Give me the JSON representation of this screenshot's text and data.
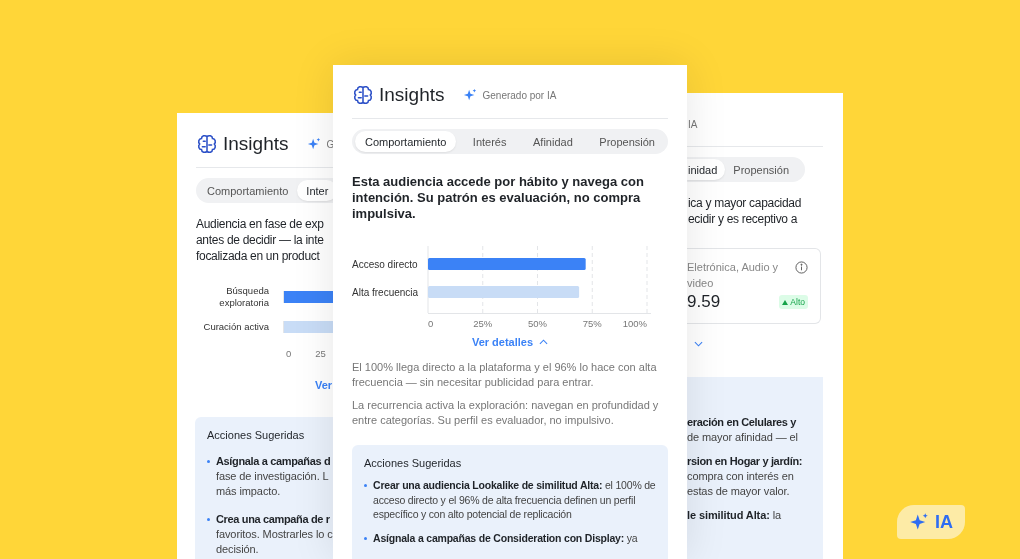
{
  "left_card": {
    "title": "Insights",
    "ai_label": "G",
    "tabs": [
      {
        "label": "Comportamiento",
        "selected": false
      },
      {
        "label": "Inter",
        "selected": true
      }
    ],
    "summary_lines": [
      "Audiencia en fase de exp",
      "antes de decidir — la inte",
      "focalizada en un product"
    ],
    "chart": {
      "categories": [
        "Búsqueda exploratoria",
        "Curación activa"
      ],
      "ticks": [
        "0",
        "25"
      ]
    },
    "link": "Ver",
    "actions": {
      "title": "Acciones Sugeridas",
      "items": [
        {
          "lines": [
            {
              "text": "Asígnala a campañas d",
              "bold": true
            },
            {
              "text": "fase de investigación. L",
              "bold": false
            },
            {
              "text": "más impacto.",
              "bold": false
            }
          ]
        },
        {
          "lines": [
            {
              "text": "Crea una campaña de r",
              "bold": true
            },
            {
              "text": "favoritos. Mostrarles lo c",
              "bold": false
            },
            {
              "text": "decisión.",
              "bold": false
            }
          ]
        }
      ]
    }
  },
  "center_card": {
    "title": "Insights",
    "ai_label": "Generado por IA",
    "tabs": [
      {
        "label": "Comportamiento",
        "selected": true
      },
      {
        "label": "Interés",
        "selected": false
      },
      {
        "label": "Afinidad",
        "selected": false
      },
      {
        "label": "Propensión",
        "selected": false
      }
    ],
    "summary": "Esta audiencia accede por hábito y navega con intención. Su patrón es evaluación, no compra impulsiva.",
    "chart_data": {
      "type": "bar",
      "orientation": "horizontal",
      "grid": true,
      "categories": [
        "Acceso directo",
        "Alta frecuencia"
      ],
      "series": [
        {
          "color": "#3b82f6",
          "values": [
            72,
            null
          ]
        },
        {
          "color": "#c8dcf6",
          "values": [
            null,
            69
          ]
        }
      ],
      "xlim": [
        0,
        100
      ],
      "xticks": [
        {
          "value": 0,
          "label": "0"
        },
        {
          "value": 25,
          "label": "25%"
        },
        {
          "value": 50,
          "label": "50%"
        },
        {
          "value": 75,
          "label": "75%"
        },
        {
          "value": 100,
          "label": "100%"
        }
      ]
    },
    "details_link": "Ver detalles",
    "expanded": true,
    "paragraphs": [
      "El 100% llega directo a la plataforma y el 96% lo hace con alta frecuencia — sin necesitar publicidad para entrar.",
      "La recurrencia activa la exploración: navegan en profundidad y entre categorías. Su perfil es evaluador, no impulsivo."
    ],
    "actions": {
      "title": "Acciones Sugeridas",
      "items": [
        "**Crear una audiencia Lookalike de similitud Alta:** el 100% de acceso directo y el 96% de alta frecuencia definen un perfil específico y con alto potencial de replicación",
        "**Asígnala a campañas de Consideration con Display:** ya"
      ]
    }
  },
  "right_card": {
    "ai_label": "IA",
    "tabs": [
      {
        "label": "inidad",
        "selected": true
      },
      {
        "label": "Propensión",
        "selected": false
      }
    ],
    "summary_lines": [
      "ica y mayor capacidad",
      "ecidir y es receptivo a"
    ],
    "metric": {
      "label_lines": [
        "Eletrónica, Audio y",
        "video"
      ],
      "value": "9.59",
      "badge": "Alto"
    },
    "expanded": false,
    "actions": {
      "items": [
        {
          "lines": [
            {
              "text": "eración en Celulares y",
              "bold": true
            },
            {
              "text": "de mayor afinidad — el",
              "bold": false
            }
          ]
        },
        {
          "lines": [
            {
              "text": "rsion en Hogar y jardín:",
              "bold": true
            },
            {
              "text": "compra con interés en",
              "bold": false
            },
            {
              "text": "estas de mayor valor.",
              "bold": false
            }
          ]
        },
        {
          "lines": [
            {
              "text": "**le similitud Alta:** la",
              "bold": false
            }
          ]
        }
      ]
    }
  },
  "ai_badge": {
    "label": "IA"
  }
}
